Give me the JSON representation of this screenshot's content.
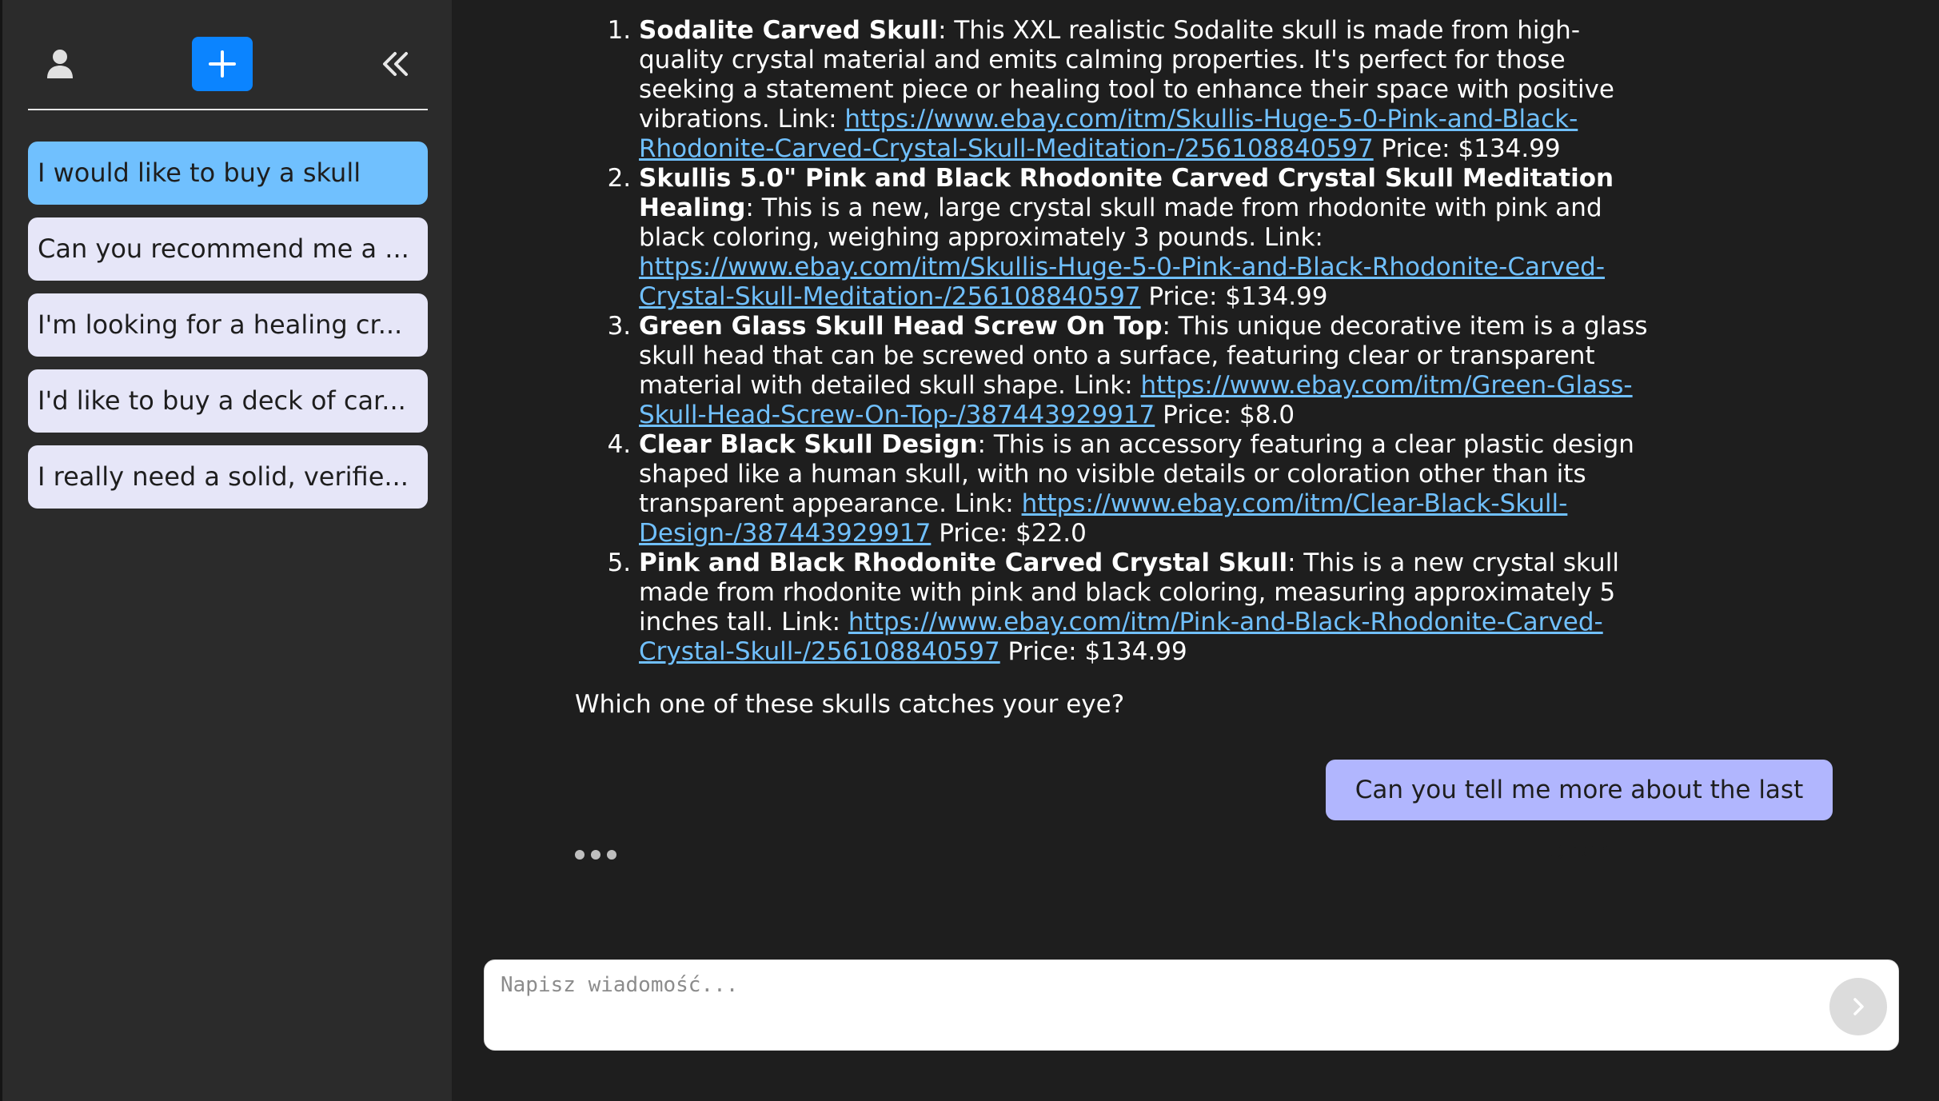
{
  "sidebar": {
    "chats": [
      {
        "label": "I would like to buy a skull",
        "active": true
      },
      {
        "label": "Can you recommend me a ...",
        "active": false
      },
      {
        "label": "I'm looking for a healing cr...",
        "active": false
      },
      {
        "label": "I'd like to buy a deck of car...",
        "active": false
      },
      {
        "label": "I really need a solid, verifie...",
        "active": false
      }
    ],
    "icons": {
      "user": "user-icon",
      "new_chat": "plus-icon",
      "collapse": "double-chevron-left-icon"
    },
    "colors": {
      "accent": "#0b84ff",
      "active_chat": "#70c0fe",
      "chat_item": "#e6e6f8"
    }
  },
  "conversation": {
    "items": [
      {
        "num": "1.",
        "name": "Sodalite Carved Skull",
        "desc": ": This XXL realistic Sodalite skull is made from high-quality crystal material and emits calming properties. It's perfect for those seeking a statement piece or healing tool to enhance their space with positive vibrations. Link: ",
        "link": "https://www.ebay.com/itm/Skullis-Huge-5-0-Pink-and-Black-Rhodonite-Carved-Crystal-Skull-Meditation-/256108840597",
        "price": " Price: $134.99"
      },
      {
        "num": "2.",
        "name": "Skullis 5.0\" Pink and Black Rhodonite Carved Crystal Skull Meditation Healing",
        "desc": ": This is a new, large crystal skull made from rhodonite with pink and black coloring, weighing approximately 3 pounds. Link: ",
        "link": "https://www.ebay.com/itm/Skullis-Huge-5-0-Pink-and-Black-Rhodonite-Carved-Crystal-Skull-Meditation-/256108840597",
        "price": " Price: $134.99"
      },
      {
        "num": "3.",
        "name": "Green Glass Skull Head Screw On Top",
        "desc": ": This unique decorative item is a glass skull head that can be screwed onto a surface, featuring clear or transparent material with detailed skull shape. Link: ",
        "link": "https://www.ebay.com/itm/Green-Glass-Skull-Head-Screw-On-Top-/387443929917",
        "price": " Price: $8.0"
      },
      {
        "num": "4.",
        "name": "Clear Black Skull Design",
        "desc": ": This is an accessory featuring a clear plastic design shaped like a human skull, with no visible details or coloration other than its transparent appearance. Link: ",
        "link": "https://www.ebay.com/itm/Clear-Black-Skull-Design-/387443929917",
        "price": " Price: $22.0"
      },
      {
        "num": "5.",
        "name": "Pink and Black Rhodonite Carved Crystal Skull",
        "desc": ": This is a new crystal skull made from rhodonite with pink and black coloring, measuring approximately 5 inches tall. Link: ",
        "link": "https://www.ebay.com/itm/Pink-and-Black-Rhodonite-Carved-Crystal-Skull-/256108840597",
        "price": " Price: $134.99"
      }
    ],
    "question": "Which one of these skulls catches your eye?",
    "user_message": "Can you tell me more about the last one?",
    "colors": {
      "link": "#70c0fe",
      "user_bubble": "#b1b6fe"
    }
  },
  "composer": {
    "placeholder": "Napisz wiadomość...",
    "send_icon": "chevron-right-icon"
  }
}
